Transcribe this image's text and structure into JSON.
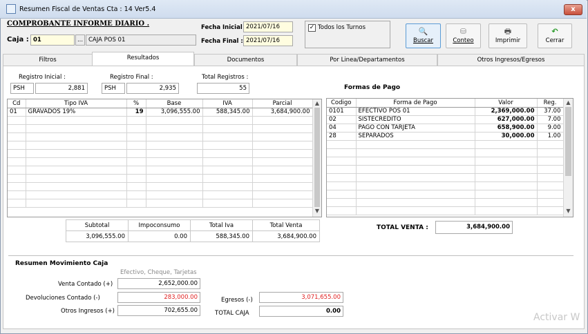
{
  "window": {
    "title": "Resumen Fiscal de Ventas Cta : 14 Ver5.4",
    "close_glyph": "x"
  },
  "header": {
    "report_title": "COMPROBANTE  INFORME DIARIO .",
    "caja_label": "Caja :",
    "caja_code": "01",
    "caja_browse": "...",
    "caja_name": "CAJA POS 01",
    "fecha_inicial_label": "Fecha Inicial :",
    "fecha_inicial": "2021/07/16",
    "fecha_final_label": "Fecha Final :",
    "fecha_final": "2021/07/16",
    "todos_turnos_label": "Todos los Turnos",
    "todos_turnos_checked": true
  },
  "toolbar": {
    "buscar": "Buscar",
    "conteo": "Conteo",
    "imprimir": "Imprimir",
    "cerrar": "Cerrar"
  },
  "tabs": [
    "Filtros",
    "Resultados",
    "Documentos",
    "Por Linea/Departamentos",
    "Otros Ingresos/Egresos"
  ],
  "registros": {
    "inicial_label": "Registro Inicial :",
    "inicial_prefix": "PSH",
    "inicial_value": "2,881",
    "final_label": "Registro Final :",
    "final_prefix": "PSH",
    "final_value": "2,935",
    "total_label": "Total Registros :",
    "total_value": "55"
  },
  "iva_table": {
    "headers": [
      "Cd",
      "Tipo IVA",
      "%",
      "Base",
      "IVA",
      "Parcial"
    ],
    "rows": [
      [
        "01",
        "GRAVADOS 19%",
        "19",
        "3,096,555.00",
        "588,345.00",
        "3,684,900.00"
      ]
    ]
  },
  "summary": {
    "headers": [
      "Subtotal",
      "Impoconsumo",
      "Total Iva",
      "Total Venta"
    ],
    "values": [
      "3,096,555.00",
      "0.00",
      "588,345.00",
      "3,684,900.00"
    ]
  },
  "pagos": {
    "title": "Formas de Pago",
    "headers": [
      "Codigo",
      "Forma de Pago",
      "Valor",
      "Reg."
    ],
    "rows": [
      [
        "0101",
        "EFECTIVO POS 01",
        "2,369,000.00",
        "37.00"
      ],
      [
        "02",
        "SISTECREDITO",
        "627,000.00",
        "7.00"
      ],
      [
        "04",
        "PAGO CON TARJETA",
        "658,900.00",
        "9.00"
      ],
      [
        "28",
        "SEPARADOS",
        "30,000.00",
        "1.00"
      ]
    ],
    "total_label": "TOTAL VENTA :",
    "total_value": "3,684,900.00"
  },
  "caja_mov": {
    "title": "Resumen Movimiento Caja",
    "subtitle": "Efectivo, Cheque, Tarjetas",
    "venta_contado_label": "Venta Contado  (+)",
    "venta_contado": "2,652,000.00",
    "devoluciones_label": "Devoluciones Contado   (-)",
    "devoluciones": "283,000.00",
    "otros_ingresos_label": "Otros Ingresos (+)",
    "otros_ingresos": "702,655.00",
    "egresos_label": "Egresos  (-)",
    "egresos": "3,071,655.00",
    "total_caja_label": "TOTAL CAJA",
    "total_caja": "0.00"
  },
  "watermark": "Activar W"
}
